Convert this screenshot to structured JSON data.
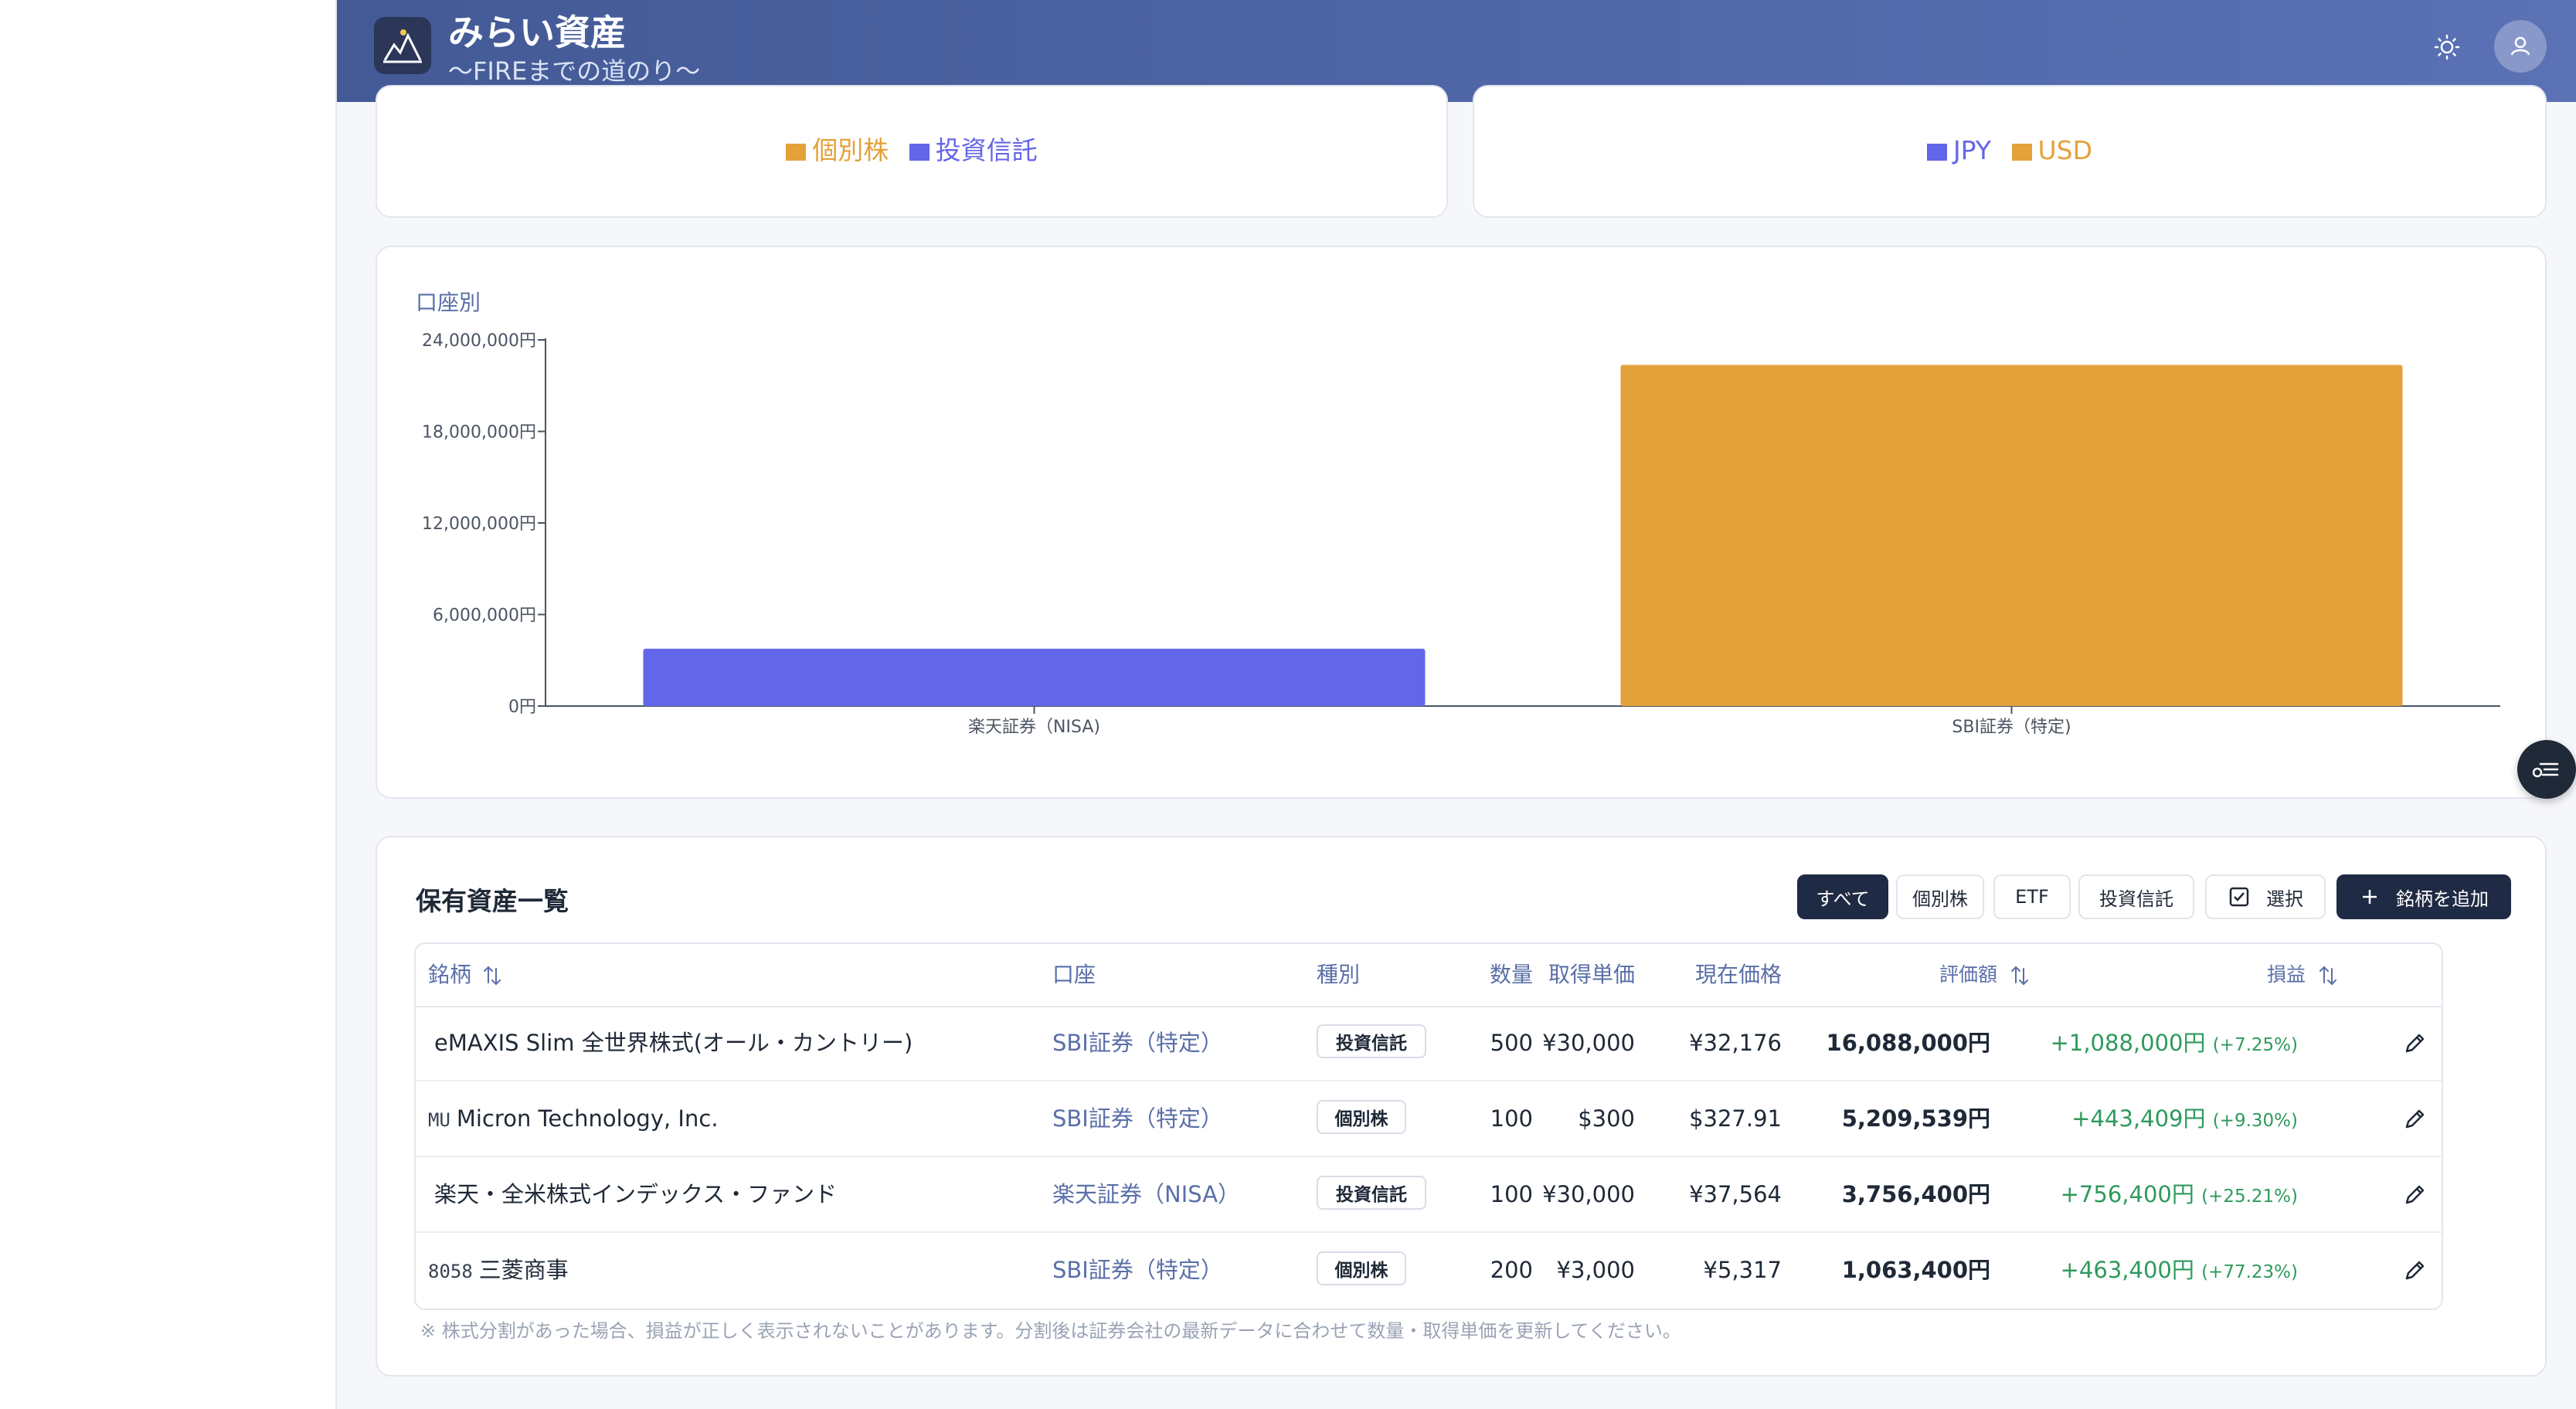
{
  "app": {
    "title": "みらい資産",
    "subtitle": "〜FIREまでの道のり〜"
  },
  "legend_type": {
    "items": [
      {
        "label": "個別株",
        "color": "#e5a13a"
      },
      {
        "label": "投資信託",
        "color": "#6366e8"
      }
    ]
  },
  "legend_currency": {
    "items": [
      {
        "label": "JPY",
        "color": "#6366e8"
      },
      {
        "label": "USD",
        "color": "#e5a13a"
      }
    ]
  },
  "account_chart": {
    "title": "口座別"
  },
  "chart_data": {
    "type": "bar",
    "title": "口座別",
    "categories": [
      "楽天証券（NISA)",
      "SBI証券（特定)"
    ],
    "values": [
      3756400,
      22360539
    ],
    "colors": [
      "#6366e8",
      "#e5a13a"
    ],
    "ylim": [
      0,
      24000000
    ],
    "yticks": [
      0,
      6000000,
      12000000,
      18000000,
      24000000
    ],
    "ytick_labels": [
      "0円",
      "6,000,000円",
      "12,000,000円",
      "18,000,000円",
      "24,000,000円"
    ],
    "grid": false
  },
  "holdings": {
    "title": "保有資産一覧",
    "filters": {
      "all": "すべて",
      "stock": "個別株",
      "etf": "ETF",
      "fund": "投資信託"
    },
    "select_label": "選択",
    "add_label": "銘柄を追加",
    "columns": {
      "name": "銘柄",
      "account": "口座",
      "type": "種別",
      "qty": "数量",
      "cost": "取得単価",
      "price": "現在価格",
      "value": "評価額",
      "pl": "損益"
    },
    "rows": [
      {
        "ticker": "",
        "name": "eMAXIS Slim 全世界株式(オール・カントリー)",
        "account": "SBI証券（特定）",
        "type": "投資信託",
        "qty": "500",
        "cost": "¥30,000",
        "price": "¥32,176",
        "value": "16,088,000円",
        "pl": "+1,088,000円",
        "pl_pct": "(+7.25%)"
      },
      {
        "ticker": "MU",
        "name": "Micron Technology, Inc.",
        "account": "SBI証券（特定）",
        "type": "個別株",
        "qty": "100",
        "cost": "$300",
        "price": "$327.91",
        "value": "5,209,539円",
        "pl": "+443,409円",
        "pl_pct": "(+9.30%)"
      },
      {
        "ticker": "",
        "name": "楽天・全米株式インデックス・ファンド",
        "account": "楽天証券（NISA）",
        "type": "投資信託",
        "qty": "100",
        "cost": "¥30,000",
        "price": "¥37,564",
        "value": "3,756,400円",
        "pl": "+756,400円",
        "pl_pct": "(+25.21%)"
      },
      {
        "ticker": "8058",
        "name": "三菱商事",
        "account": "SBI証券（特定）",
        "type": "個別株",
        "qty": "200",
        "cost": "¥3,000",
        "price": "¥5,317",
        "value": "1,063,400円",
        "pl": "+463,400円",
        "pl_pct": "(+77.23%)"
      }
    ],
    "note": "※ 株式分割があった場合、損益が正しく表示されないことがあります。分割後は証券会社の最新データに合わせて数量・取得単価を更新してください。"
  }
}
